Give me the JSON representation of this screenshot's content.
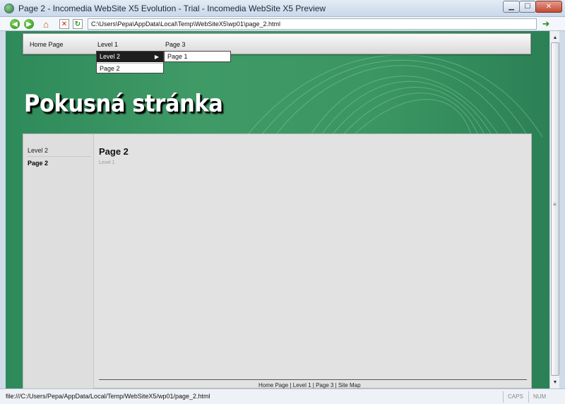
{
  "window": {
    "title": "Page 2 - Incomedia WebSite X5 Evolution - Trial - Incomedia WebSite X5 Preview",
    "minimize_glyph": "▁",
    "maximize_glyph": "☐",
    "close_glyph": "✕"
  },
  "toolbar": {
    "address": "C:\\Users\\Pepa\\AppData\\Local\\Temp\\WebSiteX5\\wp01\\page_2.html",
    "icons": [
      "back-icon",
      "forward-icon",
      "home-icon",
      "stop-icon",
      "refresh-icon",
      "go-icon"
    ]
  },
  "site": {
    "menu": {
      "home": "Home Page",
      "level1": "Level 1",
      "page3": "Page 3",
      "submenu_level2": "Level 2",
      "submenu_page2": "Page 2",
      "flyout_page1": "Page 1"
    },
    "title": "Pokusná stránka",
    "sidebar": {
      "level2": "Level 2",
      "page2": "Page 2"
    },
    "page_title": "Page 2",
    "breadcrumb": "Level 1",
    "footer": "Home Page | Level 1 | Page 3 | Site Map"
  },
  "status": {
    "url": "file:///C:/Users/Pepa/AppData/Local/Temp/WebSiteX5/wp01/page_2.html",
    "caps": "CAPS",
    "num": "NUM"
  },
  "colors": {
    "banner_green": "#3a9562",
    "content_grey": "#e2e2e2",
    "menu_highlight": "#1e1e1e"
  }
}
